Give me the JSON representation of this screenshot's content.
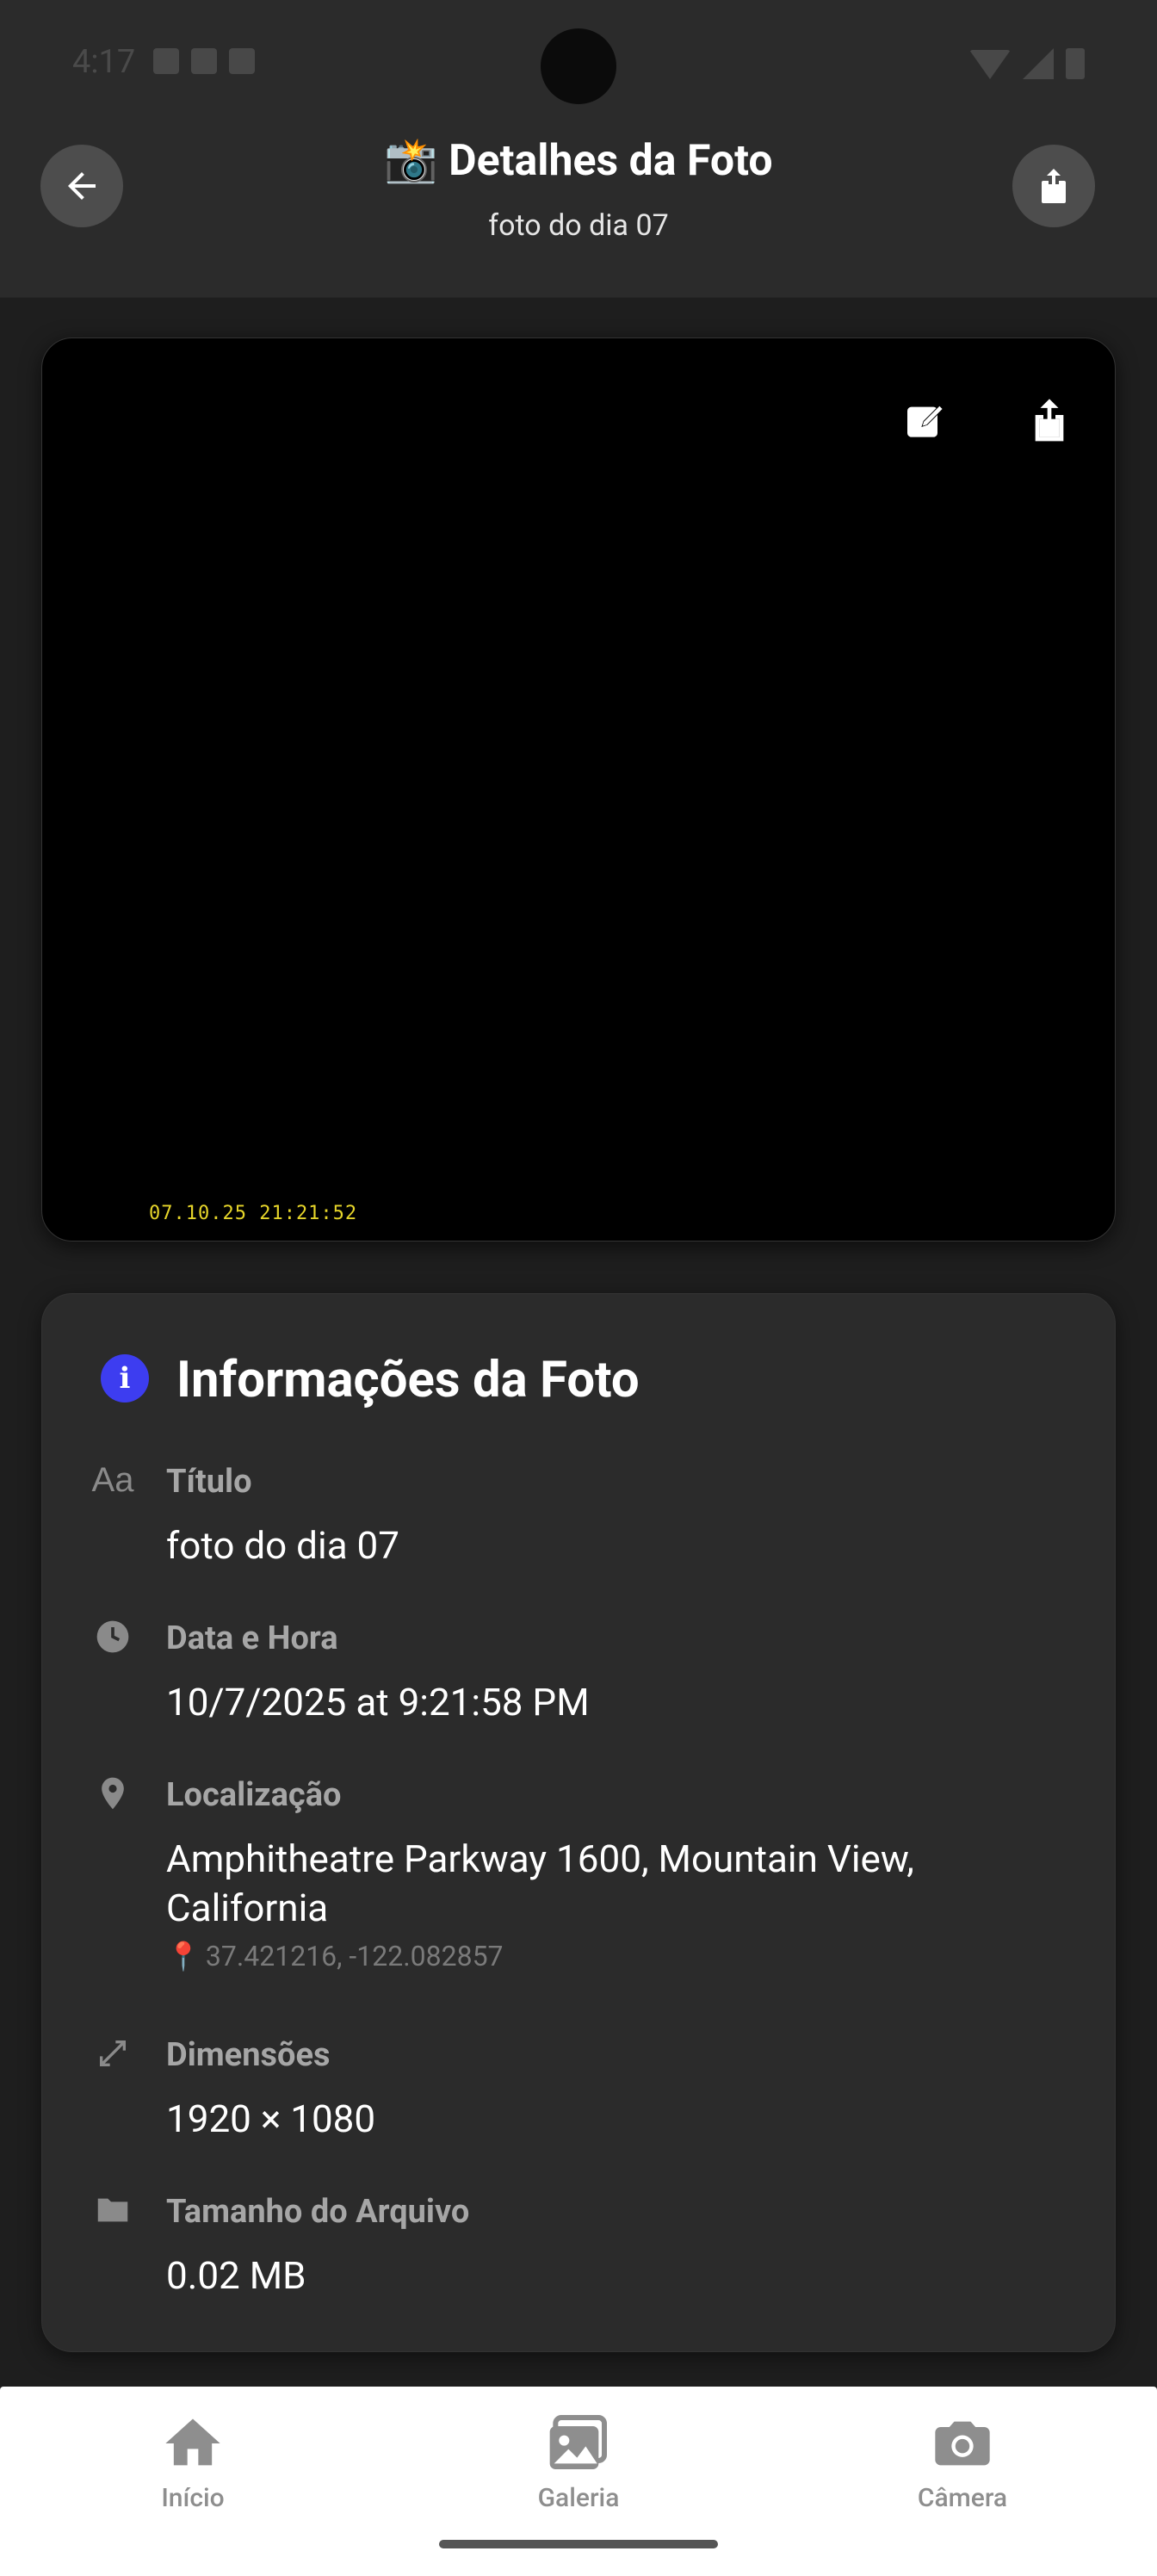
{
  "status_bar": {
    "time": "4:17"
  },
  "header": {
    "title": "📸 Detalhes da Foto",
    "subtitle": "foto do dia 07",
    "back_icon": "arrow-left-icon",
    "share_icon": "share-icon"
  },
  "photo": {
    "timestamp": "07.10.25 21:21:52",
    "edit_icon": "edit-icon",
    "share_icon": "share-icon"
  },
  "info": {
    "title": "Informações da Foto",
    "info_icon_glyph": "i",
    "rows": [
      {
        "icon": "text-icon",
        "label": "Título",
        "value": "foto do dia 07"
      },
      {
        "icon": "clock-icon",
        "label": "Data e Hora",
        "value": "10/7/2025 at 9:21:58 PM"
      },
      {
        "icon": "location-pin-icon",
        "label": "Localização",
        "value": "Amphitheatre Parkway 1600, Mountain View, California",
        "coords": "37.421216, -122.082857"
      },
      {
        "icon": "expand-icon",
        "label": "Dimensões",
        "value": "1920 × 1080"
      },
      {
        "icon": "folder-icon",
        "label": "Tamanho do Arquivo",
        "value": "0.02 MB"
      }
    ]
  },
  "nav": {
    "items": [
      {
        "label": "Início",
        "icon": "home-icon"
      },
      {
        "label": "Galeria",
        "icon": "gallery-icon"
      },
      {
        "label": "Câmera",
        "icon": "camera-icon"
      }
    ]
  },
  "colors": {
    "background": "#1e1e1e",
    "header": "#2b2b2b",
    "card": "#2b2b2b",
    "accent_info": "#3d3df0",
    "timestamp": "#e6d52a",
    "nav_background": "#ffffff",
    "nav_label": "#8e8e8e"
  }
}
